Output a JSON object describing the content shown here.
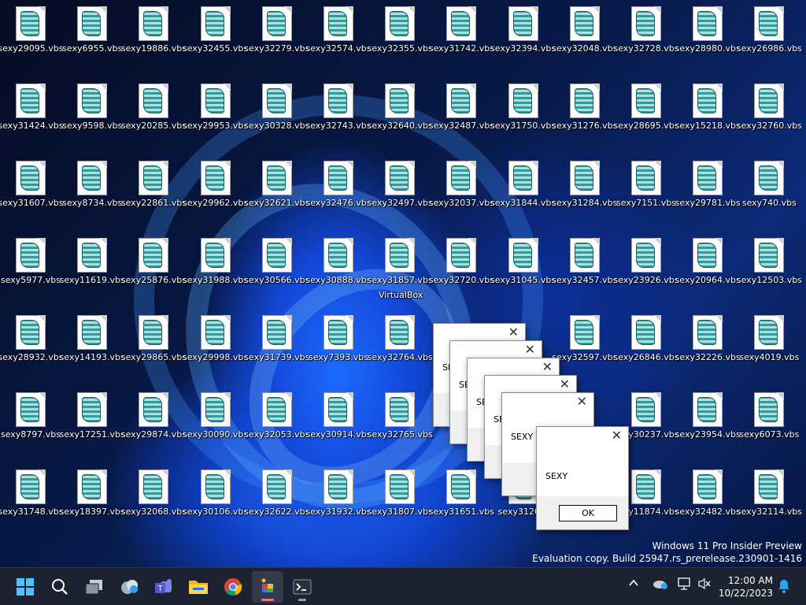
{
  "desktop": {
    "icons": [
      [
        "sexy29095.vbs",
        "sexy6955.vbs",
        "sexy19886.vbs",
        "sexy32455.vbs",
        "sexy32279.vbs",
        "sexy32574.vbs",
        "sexy32355.vbs",
        "sexy31742.vbs",
        "sexy32394.vbs",
        "sexy32048.vbs",
        "sexy32728.vbs",
        "sexy28980.vbs",
        "sexy26986.vbs"
      ],
      [
        "sexy31424.vbs",
        "sexy9598.vbs",
        "sexy20285.vbs",
        "sexy29953.vbs",
        "sexy30328.vbs",
        "sexy32743.vbs",
        "sexy32640.vbs",
        "sexy32487.vbs",
        "sexy31750.vbs",
        "sexy31276.vbs",
        "sexy28695.vbs",
        "sexy15218.vbs",
        "sexy32760.vbs"
      ],
      [
        "sexy31607.vbs",
        "sexy8734.vbs",
        "sexy22861.vbs",
        "sexy29962.vbs",
        "sexy32621.vbs",
        "sexy32476.vbs",
        "sexy32497.vbs",
        "sexy32037.vbs",
        "sexy31844.vbs",
        "sexy31284.vbs",
        "sexy7151.vbs",
        "sexy29781.vbs",
        "sexy740.vbs"
      ],
      [
        "sexy5977.vbs",
        "sexy11619.vbs",
        "sexy25876.vbs",
        "sexy31988.vbs",
        "sexy30566.vbs",
        "sexy30888.vbs",
        "sexy31857.vbs",
        "sexy32720.vbs",
        "sexy31045.vbs",
        "sexy32457.vbs",
        "sexy23926.vbs",
        "sexy20964.vbs",
        "sexy12503.vbs"
      ],
      [
        "sexy28932.vbs",
        "sexy14193.vbs",
        "sexy29865.vbs",
        "sexy29998.vbs",
        "sexy31739.vbs",
        "sexy7393.vbs",
        "sexy32764.vbs",
        "",
        "",
        "sexy32597.vbs",
        "sexy26846.vbs",
        "sexy32226.vbs",
        "sexy4019.vbs"
      ],
      [
        "sexy8797.vbs",
        "sexy17251.vbs",
        "sexy29874.vbs",
        "sexy30090.vbs",
        "sexy32053.vbs",
        "sexy30914.vbs",
        "sexy32765.vbs",
        "",
        "",
        "",
        "sexy30237.vbs",
        "sexy23954.vbs",
        "sexy6073.vbs"
      ],
      [
        "sexy31748.vbs",
        "sexy18397.vbs",
        "sexy32068.vbs",
        "sexy30106.vbs",
        "sexy32622.vbs",
        "sexy31932.vbs",
        "sexy31807.vbs",
        "sexy31651.vbs",
        "sexy31200.",
        "",
        "sexy11874.vbs",
        "sexy32482.vbs",
        "sexy32114.vbs"
      ]
    ],
    "icon_name": "vbs-script-icon",
    "virtualbox_label": "VirtualBox"
  },
  "dialogs": [
    {
      "text": "SE",
      "close": "✕"
    },
    {
      "text": "SE",
      "close": "✕"
    },
    {
      "text": "SE",
      "close": "✕"
    },
    {
      "text": "SE",
      "close": "✕"
    },
    {
      "text": "SEXY",
      "close": "✕"
    },
    {
      "text": "SEXY",
      "close": "✕",
      "ok": "OK"
    }
  ],
  "watermark": {
    "line1": "Windows 11 Pro Insider Preview",
    "line2": "Evaluation copy. Build 25947.rs_prerelease.230901-1416"
  },
  "taskbar": {
    "apps": [
      "start-icon",
      "search-icon",
      "task-view-icon",
      "widgets-icon",
      "teams-icon",
      "file-explorer-icon",
      "chrome-icon",
      "virtualbox-icon",
      "terminal-icon"
    ],
    "tray": [
      "chevron-up-icon",
      "onedrive-icon",
      "network-icon",
      "volume-muted-icon",
      "notification-bell-icon"
    ],
    "time": "12:00 AM",
    "date": "10/22/2023"
  },
  "colors": {
    "taskbar_bg": "#1c2230",
    "wallpaper_accent": "#1d6bff",
    "notification_accent": "#2aa4f4"
  }
}
